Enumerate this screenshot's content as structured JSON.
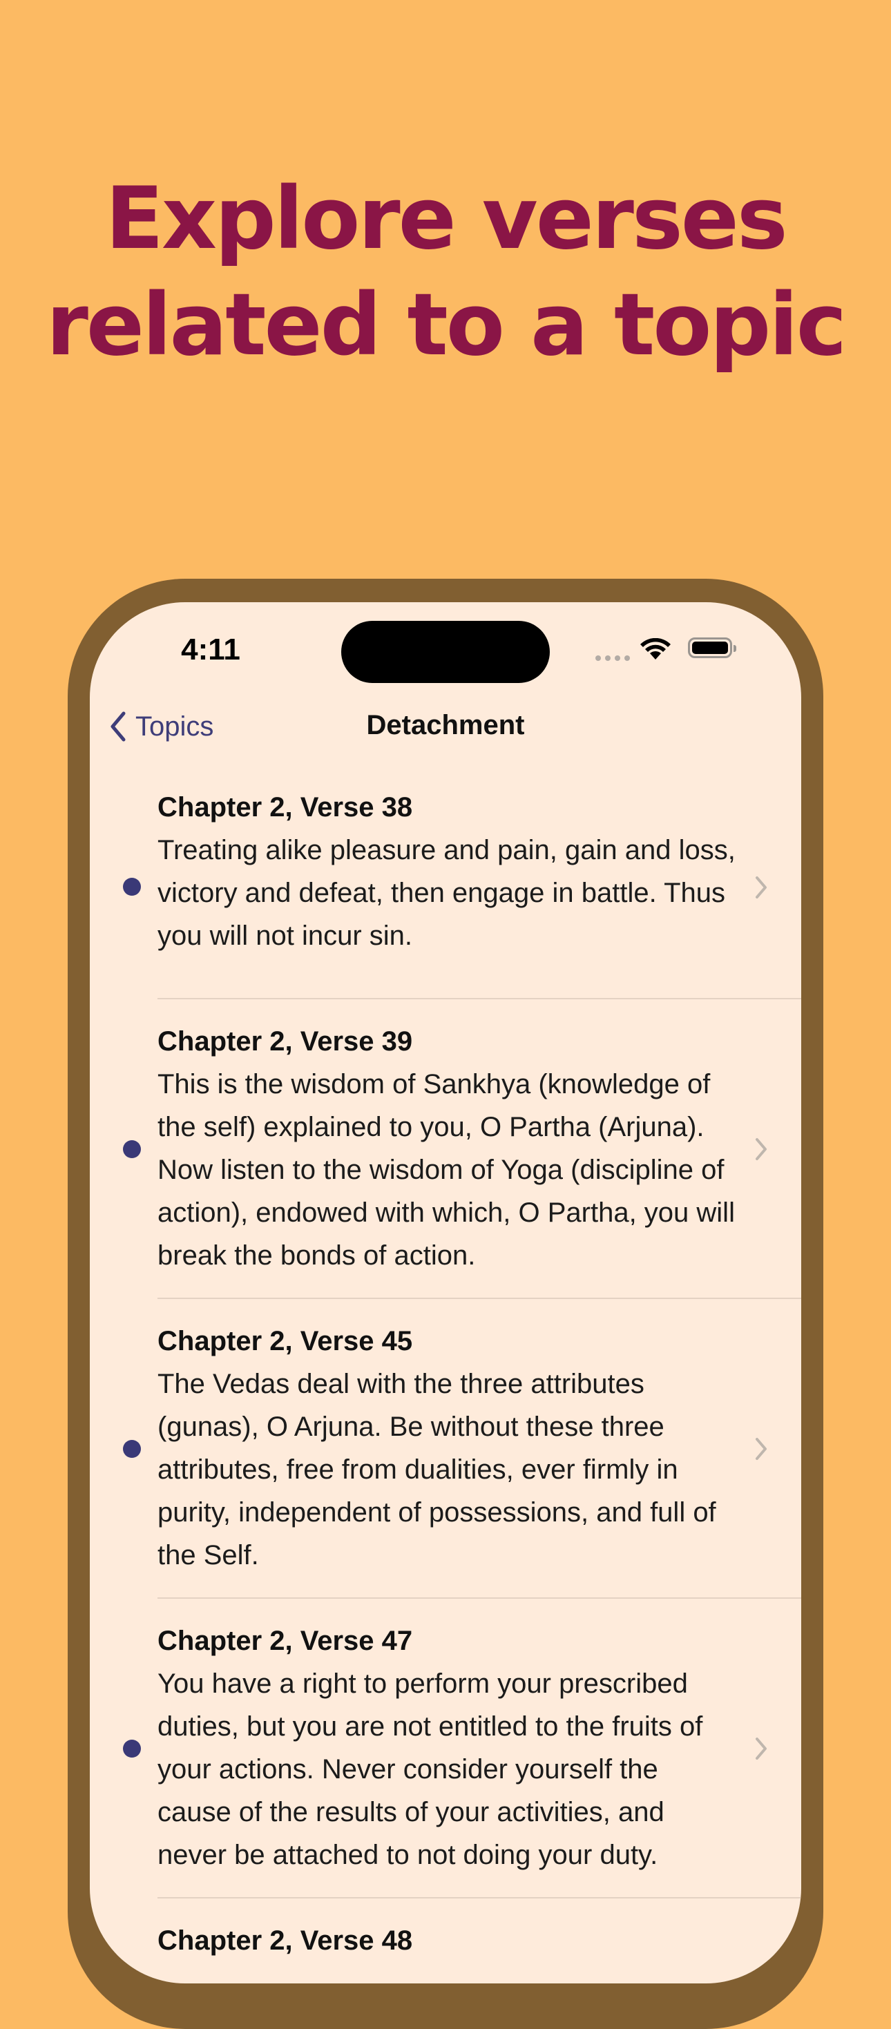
{
  "headline": {
    "line1": "Explore verses",
    "line2": "related to a topic"
  },
  "status_bar": {
    "time": "4:11"
  },
  "nav": {
    "back_label": "Topics",
    "title": "Detachment"
  },
  "verses": [
    {
      "heading": "Chapter 2, Verse 38",
      "text": "Treating alike pleasure and pain, gain and loss, victory and defeat, then engage in battle. Thus you will not incur sin."
    },
    {
      "heading": "Chapter 2, Verse 39",
      "text": "This is the wisdom of Sankhya (knowledge of the self) explained to you, O Partha (Arjuna). Now listen to the wisdom of Yoga (discipline of action), endowed with which, O Partha, you will break the bonds of action."
    },
    {
      "heading": "Chapter 2, Verse 45",
      "text": "The Vedas deal with the three attributes (gunas), O Arjuna. Be without these three attributes, free from dualities, ever firmly in purity, independent of possessions, and full of the Self."
    },
    {
      "heading": "Chapter 2, Verse 47",
      "text": "You have a right to perform your prescribed duties, but you are not entitled to the fruits of your actions. Never consider yourself the cause of the results of your activities, and never be attached to not doing your duty."
    },
    {
      "heading": "Chapter 2, Verse 48",
      "text": ""
    }
  ],
  "colors": {
    "background": "#FCBA63",
    "headline": "#8A1546",
    "frame": "#815F31",
    "screen": "#FEEBDB",
    "accent": "#3E3D79"
  },
  "icons": {
    "back": "chevron-left-icon",
    "row": "chevron-right-icon",
    "wifi": "wifi-icon",
    "battery": "battery-icon"
  }
}
